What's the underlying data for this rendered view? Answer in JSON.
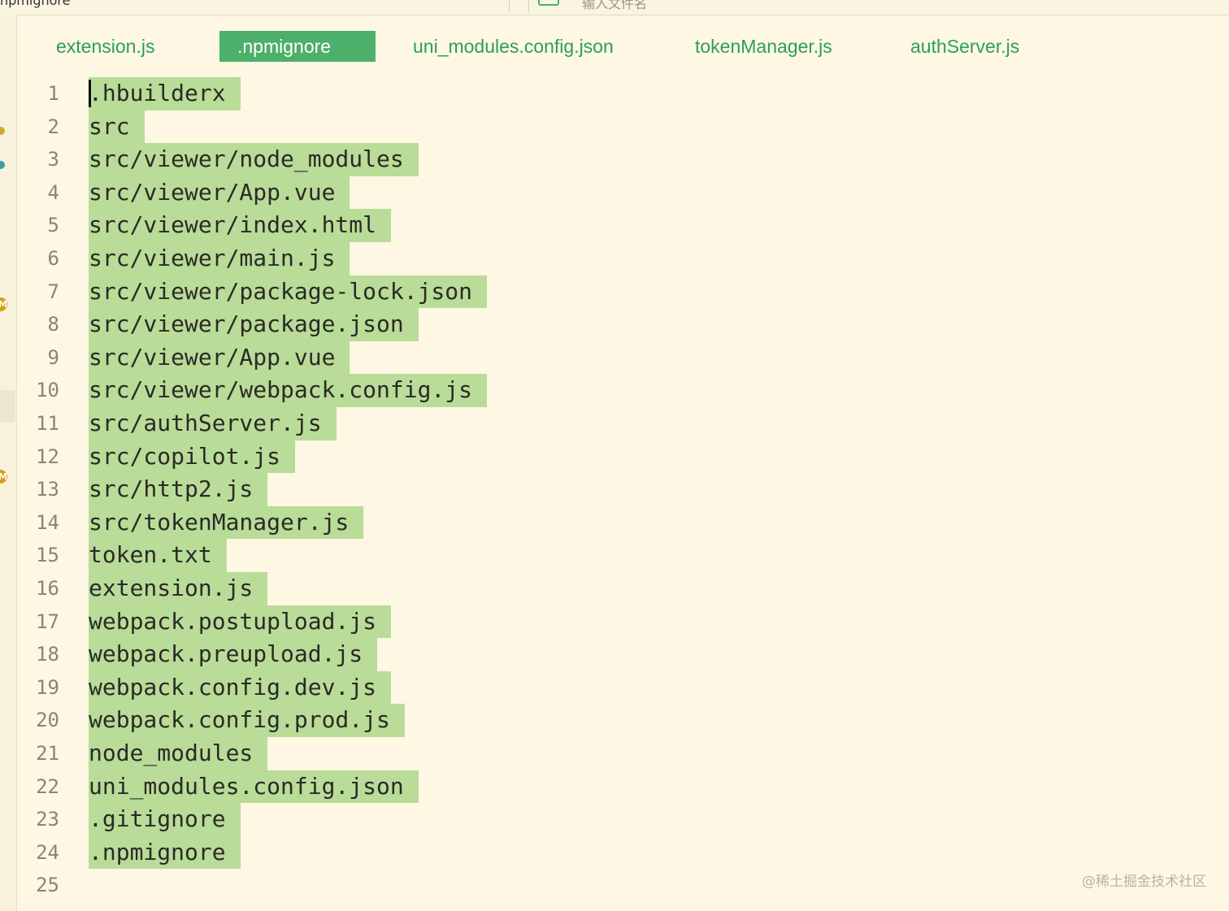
{
  "window": {
    "title": "npmignore",
    "search_placeholder": "输入文件名"
  },
  "tabs": [
    {
      "label": "extension.js",
      "active": false
    },
    {
      "label": ".npmignore",
      "active": true
    },
    {
      "label": "uni_modules.config.json",
      "active": false
    },
    {
      "label": "tokenManager.js",
      "active": false
    },
    {
      "label": "authServer.js",
      "active": false
    }
  ],
  "gutter": {
    "badge_label": "M"
  },
  "colors": {
    "accent": "#4caf6a",
    "selection": "#b9dc98",
    "background": "#fdf7e3"
  },
  "editor": {
    "lines": [
      {
        "num": "1",
        "text": ".hbuilderx"
      },
      {
        "num": "2",
        "text": "src"
      },
      {
        "num": "3",
        "text": "src/viewer/node_modules"
      },
      {
        "num": "4",
        "text": "src/viewer/App.vue"
      },
      {
        "num": "5",
        "text": "src/viewer/index.html"
      },
      {
        "num": "6",
        "text": "src/viewer/main.js"
      },
      {
        "num": "7",
        "text": "src/viewer/package-lock.json"
      },
      {
        "num": "8",
        "text": "src/viewer/package.json"
      },
      {
        "num": "9",
        "text": "src/viewer/App.vue"
      },
      {
        "num": "10",
        "text": "src/viewer/webpack.config.js"
      },
      {
        "num": "11",
        "text": "src/authServer.js"
      },
      {
        "num": "12",
        "text": "src/copilot.js"
      },
      {
        "num": "13",
        "text": "src/http2.js"
      },
      {
        "num": "14",
        "text": "src/tokenManager.js"
      },
      {
        "num": "15",
        "text": "token.txt"
      },
      {
        "num": "16",
        "text": "extension.js"
      },
      {
        "num": "17",
        "text": "webpack.postupload.js"
      },
      {
        "num": "18",
        "text": "webpack.preupload.js"
      },
      {
        "num": "19",
        "text": "webpack.config.dev.js"
      },
      {
        "num": "20",
        "text": "webpack.config.prod.js"
      },
      {
        "num": "21",
        "text": "node_modules"
      },
      {
        "num": "22",
        "text": "uni_modules.config.json"
      },
      {
        "num": "23",
        "text": ".gitignore"
      },
      {
        "num": "24",
        "text": ".npmignore"
      },
      {
        "num": "25",
        "text": ""
      }
    ]
  },
  "watermark": "@稀土掘金技术社区"
}
